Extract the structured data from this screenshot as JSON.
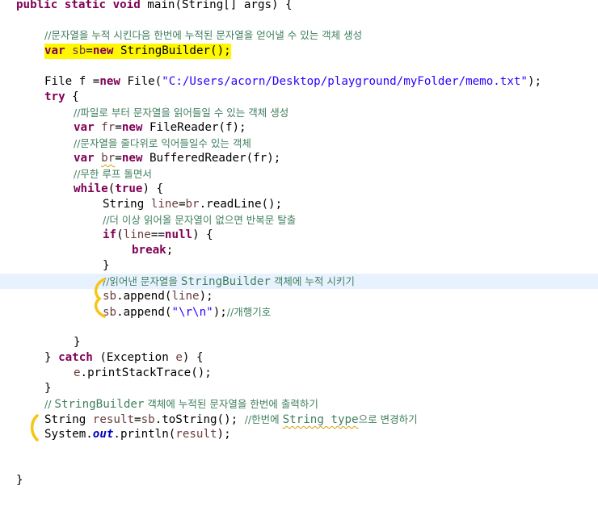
{
  "code": {
    "l1": {
      "k1": "public static void ",
      "rest": "main(String[] args) {"
    },
    "l2": {
      "comment": "//문자열을 누적 시킨다음 한번에 누적된 문자열을 얻어낼 수 있는 객체 생성"
    },
    "l3": {
      "k": "var ",
      "v": "sb",
      "eq": "=",
      "k2": "new ",
      "rest": "StringBuilder();"
    },
    "l4": {
      "a": "File f =",
      "k": "new ",
      "b": "File(",
      "s": "\"C:/Users/acorn/Desktop/playground/myFolder/memo.txt\"",
      "c": ");"
    },
    "l5": {
      "k": "try ",
      "rest": "{"
    },
    "l6": {
      "comment": "//파일로 부터 문자열을 읽어들일 수 있는 객체 생성"
    },
    "l7": {
      "k": "var ",
      "v": "fr",
      "eq": "=",
      "k2": "new ",
      "rest": "FileReader(f);"
    },
    "l8": {
      "comment": "//문자열을 줄다위로 익어들일수 있는 객체"
    },
    "l9": {
      "k": "var ",
      "v": "br",
      "eq": "=",
      "k2": "new ",
      "rest": "BufferedReader(fr);"
    },
    "l10": {
      "comment": "//무한 루프 돌면서"
    },
    "l11": {
      "k": "while",
      "a": "(",
      "k2": "true",
      "b": ") {"
    },
    "l12": {
      "a": "String ",
      "v": "line",
      "eq": "=",
      "v2": "br",
      "rest": ".readLine();"
    },
    "l13": {
      "comment": "//더 이상 읽어올 문자열이 없으면 반복문 탈출"
    },
    "l14": {
      "k": "if",
      "a": "(",
      "v": "line",
      "op": "==",
      "k2": "null",
      "b": ") {"
    },
    "l15": {
      "k": "break",
      "b": ";"
    },
    "l16": {
      "b": "}"
    },
    "l17": {
      "c1": "//읽어낸 문자열을 ",
      "c2": "StringBuilder",
      "c3": " 객체에 누적 시키기"
    },
    "l18": {
      "v": "sb",
      "a": ".append(",
      "v2": "line",
      "b": ");"
    },
    "l19": {
      "v": "sb",
      "a": ".append(",
      "s": "\"\\r\\n\"",
      "b": ");",
      "comment": "//개행기호"
    },
    "l20": {
      "b": "}"
    },
    "l21": {
      "a": "} ",
      "k": "catch ",
      "b": "(Exception ",
      "v": "e",
      "c": ") {"
    },
    "l22": {
      "v": "e",
      "rest": ".printStackTrace();"
    },
    "l23": {
      "b": "}"
    },
    "l24": {
      "c1": "// ",
      "c2": "StringBuilder",
      "c3": " 객체에 누적된 문자열을 한번에 출력하기"
    },
    "l25": {
      "a": "String ",
      "v": "result",
      "eq": "=",
      "v2": "sb",
      "b": ".toString(); ",
      "c1": "//한번에 ",
      "c2": "String type",
      "c3": "으로 변경하기"
    },
    "l26": {
      "a": "System.",
      "f": "out",
      "b": ".println(",
      "v": "result",
      "c": ");"
    },
    "l27": {
      "b": "}"
    }
  },
  "annotations": {
    "mark_color": "#f5c518"
  }
}
